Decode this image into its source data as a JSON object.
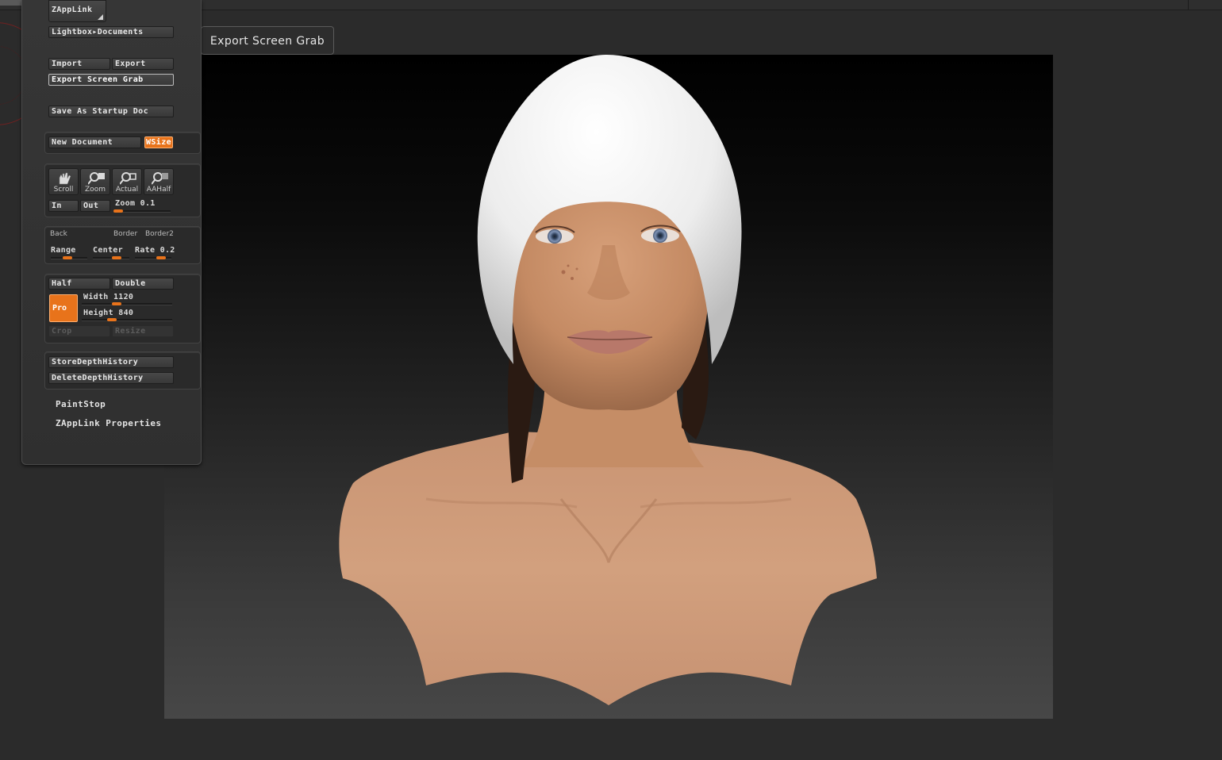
{
  "tooltip": {
    "text": "Export Screen Grab"
  },
  "palette": {
    "zapplink": "ZAppLink",
    "lightbox_documents": "Lightbox▸Documents",
    "import": "Import",
    "export": "Export",
    "export_screen_grab": "Export Screen Grab",
    "save_as_startup_doc": "Save As Startup Doc",
    "new_document": "New Document",
    "wsize": "WSize",
    "scroll": "Scroll",
    "zoom": "Zoom",
    "actual": "Actual",
    "aahalf": "AAHalf",
    "in": "In",
    "out": "Out",
    "zoom_slider": {
      "label": "Zoom",
      "value": "0.1"
    },
    "back": "Back",
    "border": "Border",
    "border2": "Border2",
    "range": "Range",
    "center": "Center",
    "rate": {
      "label": "Rate",
      "value": "0.2"
    },
    "half": "Half",
    "double": "Double",
    "pro": "Pro",
    "width": {
      "label": "Width",
      "value": "1120"
    },
    "height": {
      "label": "Height",
      "value": "840"
    },
    "crop": "Crop",
    "resize": "Resize",
    "store_depth_history": "StoreDepthHistory",
    "delete_depth_history": "DeleteDepthHistory",
    "paintstop": "PaintStop",
    "zapplink_properties": "ZAppLink Properties"
  },
  "colors": {
    "accent": "#e8731b",
    "panel": "#2f2f2f",
    "background": "#2b2b2b"
  }
}
